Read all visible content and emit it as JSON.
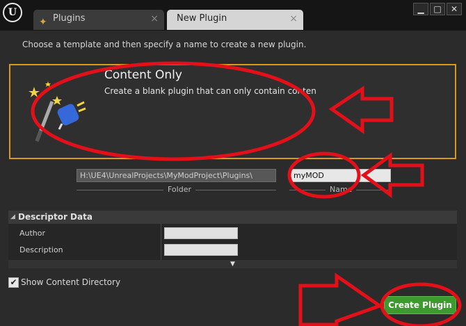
{
  "titlebar": {
    "tabs": [
      {
        "label": "Plugins",
        "icon": "plug-icon"
      },
      {
        "label": "New Plugin",
        "icon": null
      }
    ],
    "window_buttons": [
      "minimize",
      "maximize",
      "close"
    ]
  },
  "intro_text": "Choose a template and then specify a name to create a new plugin.",
  "template": {
    "title": "Content Only",
    "description": "Create a blank plugin that can only contain conten",
    "icon": "magic-wand-plug-icon"
  },
  "folder": {
    "path": "H:\\UE4\\UnrealProjects\\MyModProject\\Plugins\\",
    "label": "Folder"
  },
  "name": {
    "value": "myMOD",
    "label": "Name"
  },
  "descriptor": {
    "header": "Descriptor Data",
    "rows": [
      {
        "label": "Author",
        "value": ""
      },
      {
        "label": "Description",
        "value": ""
      }
    ]
  },
  "show_content_directory": {
    "label": "Show Content Directory",
    "checked": true
  },
  "create_button": "Create Plugin",
  "colors": {
    "accent_border": "#d79a1f",
    "create_button": "#3c9a2f",
    "annotation": "#e3101a"
  }
}
